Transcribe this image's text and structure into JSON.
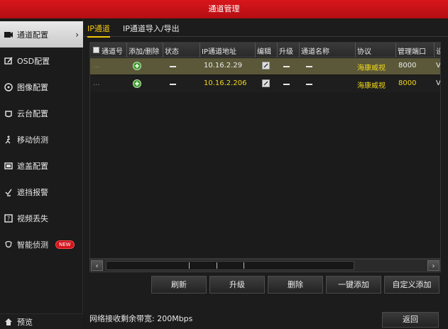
{
  "window": {
    "title": "通道管理"
  },
  "sidebar": {
    "items": [
      {
        "label": "通道配置",
        "icon": "channel-config-icon",
        "active": true
      },
      {
        "label": "OSD配置",
        "icon": "osd-icon"
      },
      {
        "label": "图像配置",
        "icon": "image-icon"
      },
      {
        "label": "云台配置",
        "icon": "ptz-icon"
      },
      {
        "label": "移动侦测",
        "icon": "motion-icon"
      },
      {
        "label": "遮盖配置",
        "icon": "mask-icon"
      },
      {
        "label": "遮挡报警",
        "icon": "tamper-alarm-icon"
      },
      {
        "label": "视频丢失",
        "icon": "video-loss-icon"
      },
      {
        "label": "智能侦测",
        "icon": "smart-detect-icon",
        "badge": "NEW"
      }
    ],
    "arrow": "›",
    "bottom": {
      "label": "预览",
      "icon": "home-icon"
    }
  },
  "tabs": [
    {
      "label": "IP通道",
      "active": true
    },
    {
      "label": "IP通道导入/导出"
    }
  ],
  "table": {
    "headers": [
      "通道号",
      "添加/删除",
      "状态",
      "IP通道地址",
      "编辑",
      "升级",
      "通道名称",
      "协议",
      "管理端口",
      "设"
    ],
    "rows": [
      {
        "channel": "...",
        "ip": "10.16.2.29",
        "protocol": "海康威视",
        "port": "8000",
        "extra": "V",
        "selected": true
      },
      {
        "channel": "...",
        "ip": "10.16.2.206",
        "protocol": "海康威视",
        "port": "8000",
        "extra": "V",
        "selected": false
      }
    ]
  },
  "scrollbar": {
    "left": "‹",
    "right": "›"
  },
  "buttons": {
    "refresh": "刷新",
    "upgrade": "升级",
    "delete": "删除",
    "one_key_add": "一键添加",
    "custom_add": "自定义添加"
  },
  "footer": {
    "bandwidth": "网络接收剩余带宽: 200Mbps",
    "back": "返回"
  },
  "colors": {
    "titlebar": "#c8101a",
    "highlight": "#f2c40a",
    "selected_row": "#5a5838"
  }
}
